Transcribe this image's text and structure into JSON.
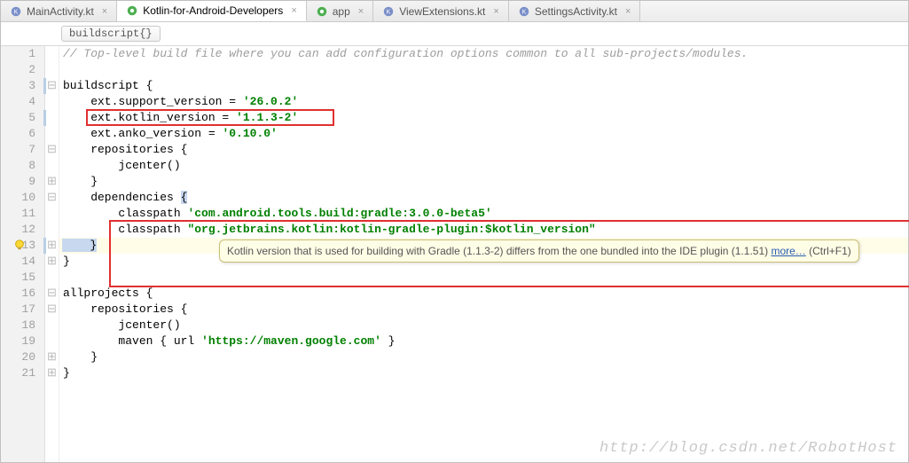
{
  "tabs": [
    {
      "label": "MainActivity.kt",
      "active": false,
      "icon": "kotlin"
    },
    {
      "label": "Kotlin-for-Android-Developers",
      "active": true,
      "icon": "gradle"
    },
    {
      "label": "app",
      "active": false,
      "icon": "gradle"
    },
    {
      "label": "ViewExtensions.kt",
      "active": false,
      "icon": "kotlin"
    },
    {
      "label": "SettingsActivity.kt",
      "active": false,
      "icon": "kotlin"
    }
  ],
  "breadcrumb": "buildscript{}",
  "gutter_lines": [
    "1",
    "2",
    "3",
    "4",
    "5",
    "6",
    "7",
    "8",
    "9",
    "10",
    "11",
    "12",
    "13",
    "14",
    "15",
    "16",
    "17",
    "18",
    "19",
    "20",
    "21"
  ],
  "code": {
    "l1_comment": "// Top-level build file where you can add configuration options common to all sub-projects/modules.",
    "l3": "buildscript {",
    "l4_a": "    ext.support_version = ",
    "l4_b": "'26.0.2'",
    "l5_a": "    ext.kotlin_version = ",
    "l5_b": "'1.1.3-2'",
    "l6_a": "    ext.anko_version = ",
    "l6_b": "'0.10.0'",
    "l7": "    repositories {",
    "l8": "        jcenter()",
    "l9": "    }",
    "l10_a": "    dependencies ",
    "l10_b": "{",
    "l11_a": "        classpath ",
    "l11_b": "'com.android.tools.build:gradle:3.0.0-beta5'",
    "l12_a": "        classpath ",
    "l12_b": "\"org.jetbrains.kotlin:kotlin-gradle-plugin:$kotlin_version\"",
    "l13": "    }",
    "l14": "}",
    "l16": "allprojects {",
    "l17": "    repositories {",
    "l18": "        jcenter()",
    "l19_a": "        maven { url ",
    "l19_b": "'https://maven.google.com'",
    "l19_c": " }",
    "l20": "    }",
    "l21": "}"
  },
  "tooltip": {
    "text": "Kotlin version that is used for building with Gradle (1.1.3-2) differs from the one bundled into the IDE plugin (1.1.51) ",
    "link": "more…",
    "suffix": " (Ctrl+F1)"
  },
  "watermark": "http://blog.csdn.net/RobotHost"
}
